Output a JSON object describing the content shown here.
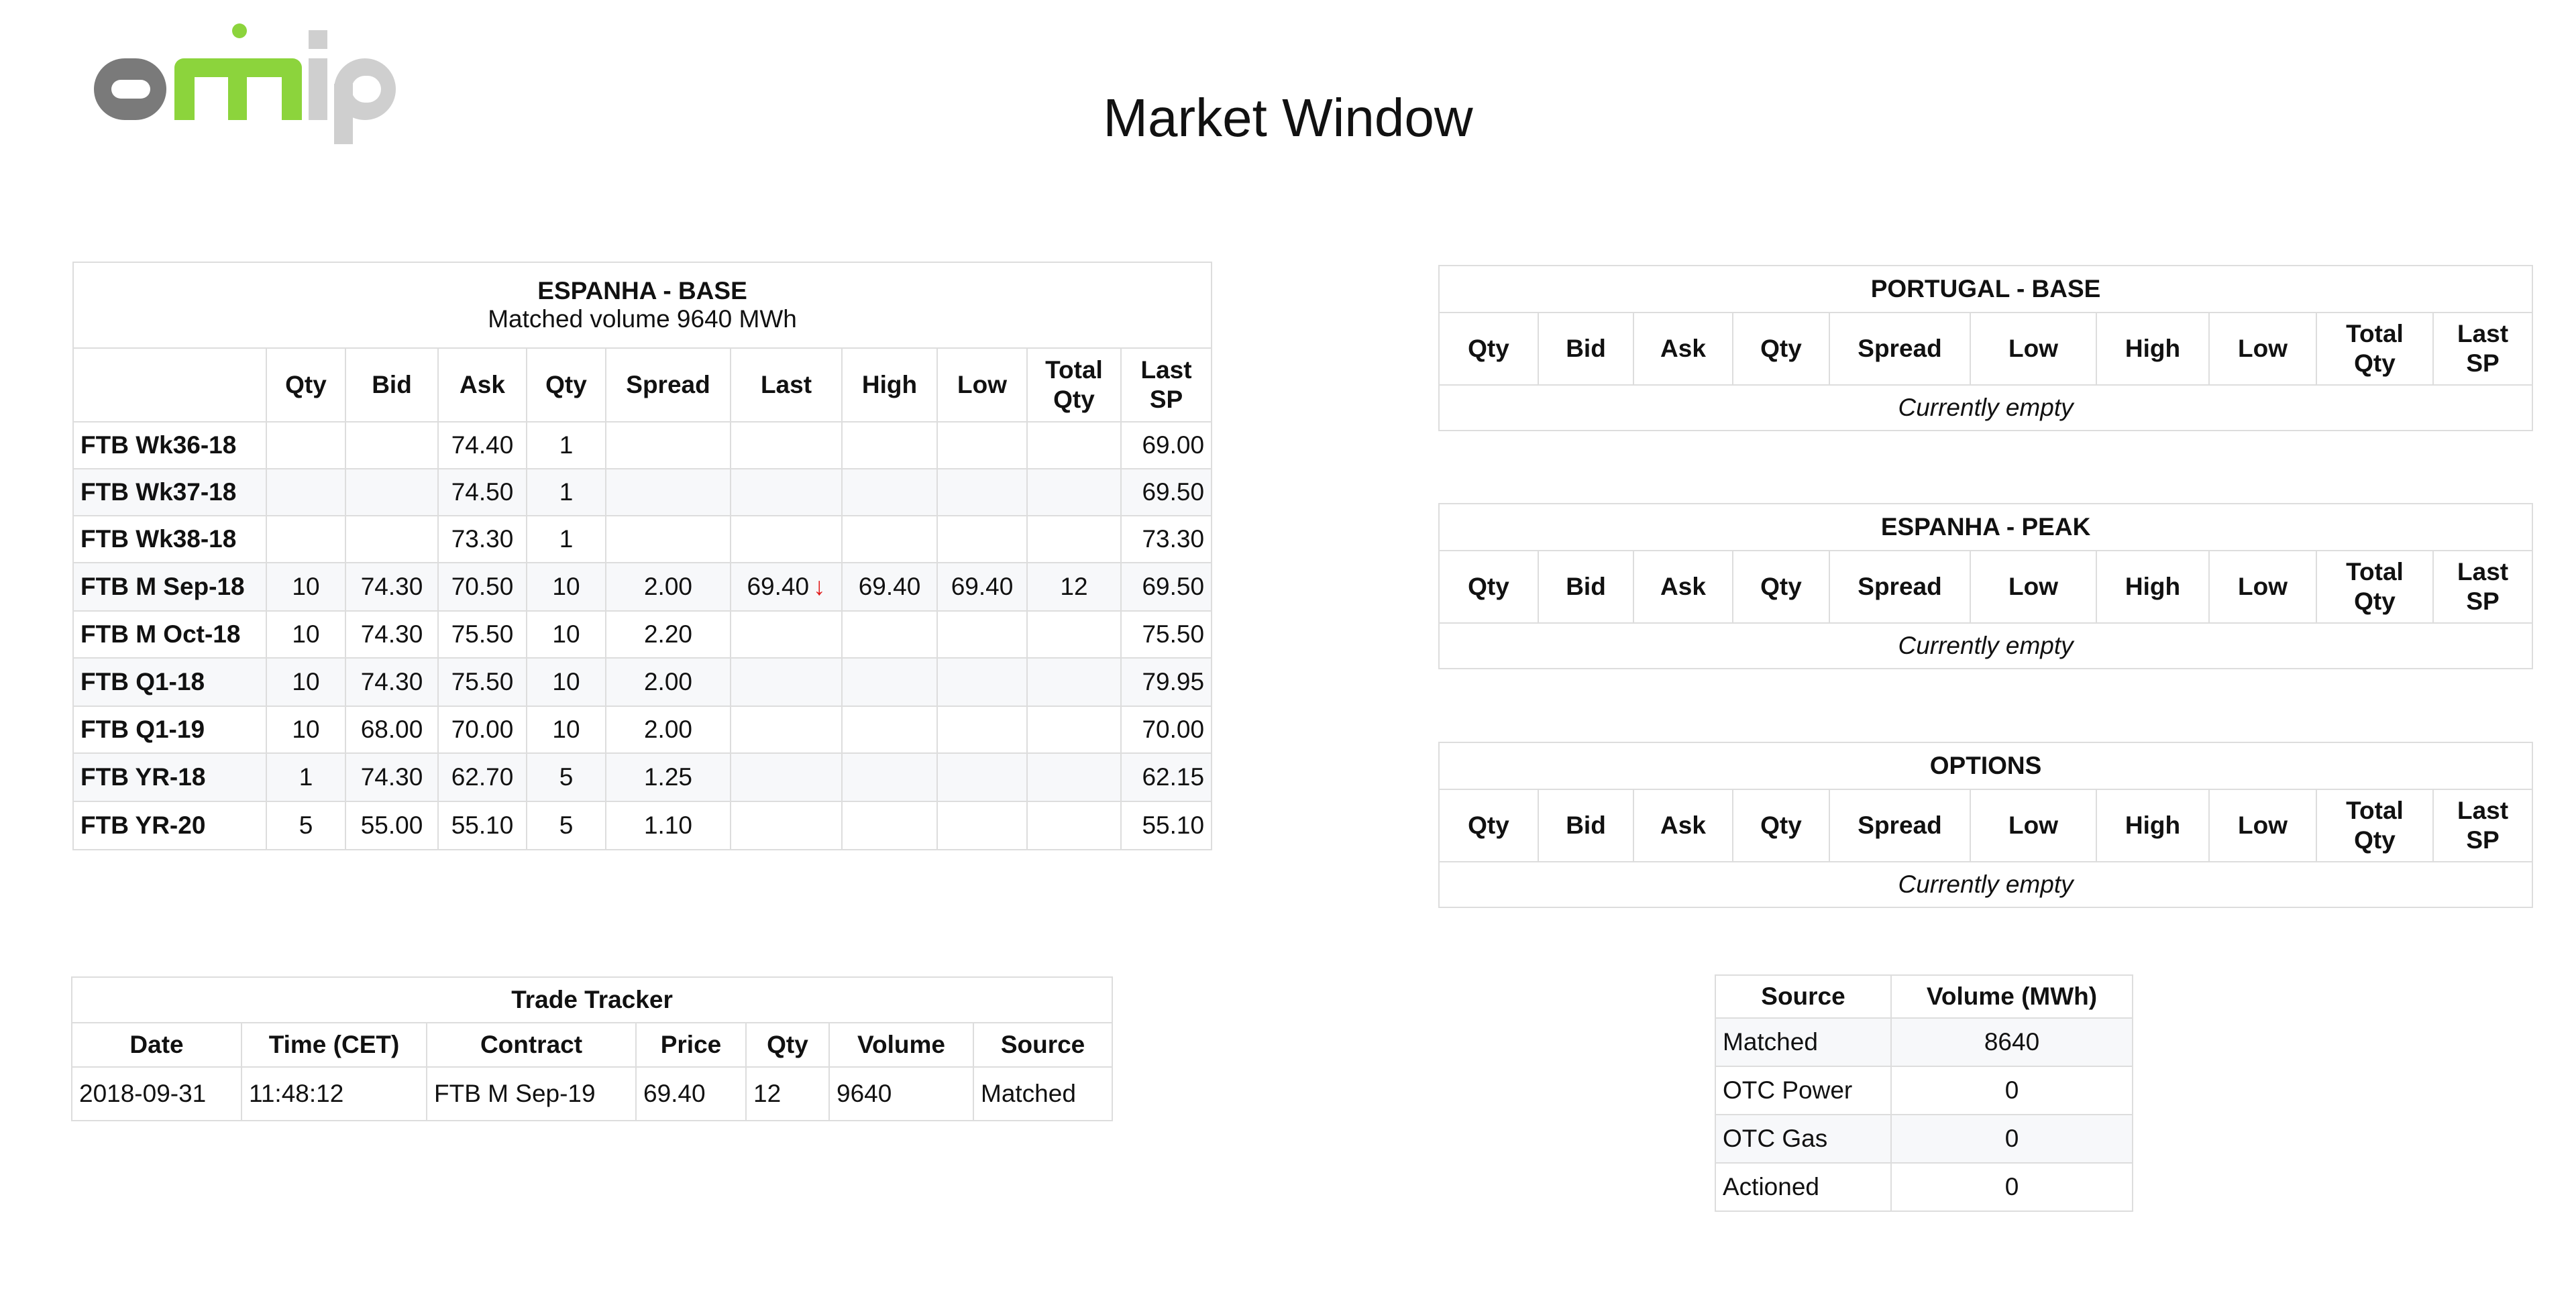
{
  "logo": {
    "part1": "o",
    "part2": "m",
    "part3": "ip"
  },
  "page": {
    "title": "Market Window"
  },
  "espanha_base": {
    "title": "ESPANHA - BASE",
    "subtitle": "Matched volume 9640 MWh",
    "headers": [
      "",
      "Qty",
      "Bid",
      "Ask",
      "Qty",
      "Spread",
      "Last",
      "High",
      "Low",
      "Total Qty",
      "Last SP"
    ],
    "rows": [
      {
        "contract": "FTB Wk36-18",
        "qty_bid": "",
        "bid": "",
        "ask": "74.40",
        "qty_ask": "1",
        "spread": "",
        "last": "",
        "last_dir": "",
        "high": "",
        "low": "",
        "total_qty": "",
        "last_sp": "69.00"
      },
      {
        "contract": "FTB Wk37-18",
        "qty_bid": "",
        "bid": "",
        "ask": "74.50",
        "qty_ask": "1",
        "spread": "",
        "last": "",
        "last_dir": "",
        "high": "",
        "low": "",
        "total_qty": "",
        "last_sp": "69.50"
      },
      {
        "contract": "FTB Wk38-18",
        "qty_bid": "",
        "bid": "",
        "ask": "73.30",
        "qty_ask": "1",
        "spread": "",
        "last": "",
        "last_dir": "",
        "high": "",
        "low": "",
        "total_qty": "",
        "last_sp": "73.30"
      },
      {
        "contract": "FTB M Sep-18",
        "qty_bid": "10",
        "bid": "74.30",
        "ask": "70.50",
        "qty_ask": "10",
        "spread": "2.00",
        "last": "69.40",
        "last_dir": "↓",
        "high": "69.40",
        "low": "69.40",
        "total_qty": "12",
        "last_sp": "69.50"
      },
      {
        "contract": "FTB M Oct-18",
        "qty_bid": "10",
        "bid": "74.30",
        "ask": "75.50",
        "qty_ask": "10",
        "spread": "2.20",
        "last": "",
        "last_dir": "",
        "high": "",
        "low": "",
        "total_qty": "",
        "last_sp": "75.50"
      },
      {
        "contract": "FTB Q1-18",
        "qty_bid": "10",
        "bid": "74.30",
        "ask": "75.50",
        "qty_ask": "10",
        "spread": "2.00",
        "last": "",
        "last_dir": "",
        "high": "",
        "low": "",
        "total_qty": "",
        "last_sp": "79.95"
      },
      {
        "contract": "FTB Q1-19",
        "qty_bid": "10",
        "bid": "68.00",
        "ask": "70.00",
        "qty_ask": "10",
        "spread": "2.00",
        "last": "",
        "last_dir": "",
        "high": "",
        "low": "",
        "total_qty": "",
        "last_sp": "70.00"
      },
      {
        "contract": "FTB YR-18",
        "qty_bid": "1",
        "bid": "74.30",
        "ask": "62.70",
        "qty_ask": "5",
        "spread": "1.25",
        "last": "",
        "last_dir": "",
        "high": "",
        "low": "",
        "total_qty": "",
        "last_sp": "62.15"
      },
      {
        "contract": "FTB YR-20",
        "qty_bid": "5",
        "bid": "55.00",
        "ask": "55.10",
        "qty_ask": "5",
        "spread": "1.10",
        "last": "",
        "last_dir": "",
        "high": "",
        "low": "",
        "total_qty": "",
        "last_sp": "55.10"
      }
    ]
  },
  "right_panels": [
    {
      "title": "PORTUGAL - BASE",
      "headers": [
        "Qty",
        "Bid",
        "Ask",
        "Qty",
        "Spread",
        "Low",
        "High",
        "Low",
        "Total Qty",
        "Last SP"
      ],
      "empty_text": "Currently empty"
    },
    {
      "title": "ESPANHA - PEAK",
      "headers": [
        "Qty",
        "Bid",
        "Ask",
        "Qty",
        "Spread",
        "Low",
        "High",
        "Low",
        "Total Qty",
        "Last SP"
      ],
      "empty_text": "Currently empty"
    },
    {
      "title": "OPTIONS",
      "headers": [
        "Qty",
        "Bid",
        "Ask",
        "Qty",
        "Spread",
        "Low",
        "High",
        "Low",
        "Total Qty",
        "Last SP"
      ],
      "empty_text": "Currently empty"
    }
  ],
  "trade_tracker": {
    "title": "Trade Tracker",
    "headers": [
      "Date",
      "Time (CET)",
      "Contract",
      "Price",
      "Qty",
      "Volume",
      "Source"
    ],
    "rows": [
      {
        "date": "2018-09-31",
        "time": "11:48:12",
        "contract": "FTB M Sep-19",
        "price": "69.40",
        "qty": "12",
        "volume": "9640",
        "source": "Matched"
      }
    ]
  },
  "volume_summary": {
    "headers": [
      "Source",
      "Volume (MWh)"
    ],
    "rows": [
      {
        "source": "Matched",
        "volume": "8640"
      },
      {
        "source": "OTC Power",
        "volume": "0"
      },
      {
        "source": "OTC Gas",
        "volume": "0"
      },
      {
        "source": "Actioned",
        "volume": "0"
      }
    ]
  }
}
